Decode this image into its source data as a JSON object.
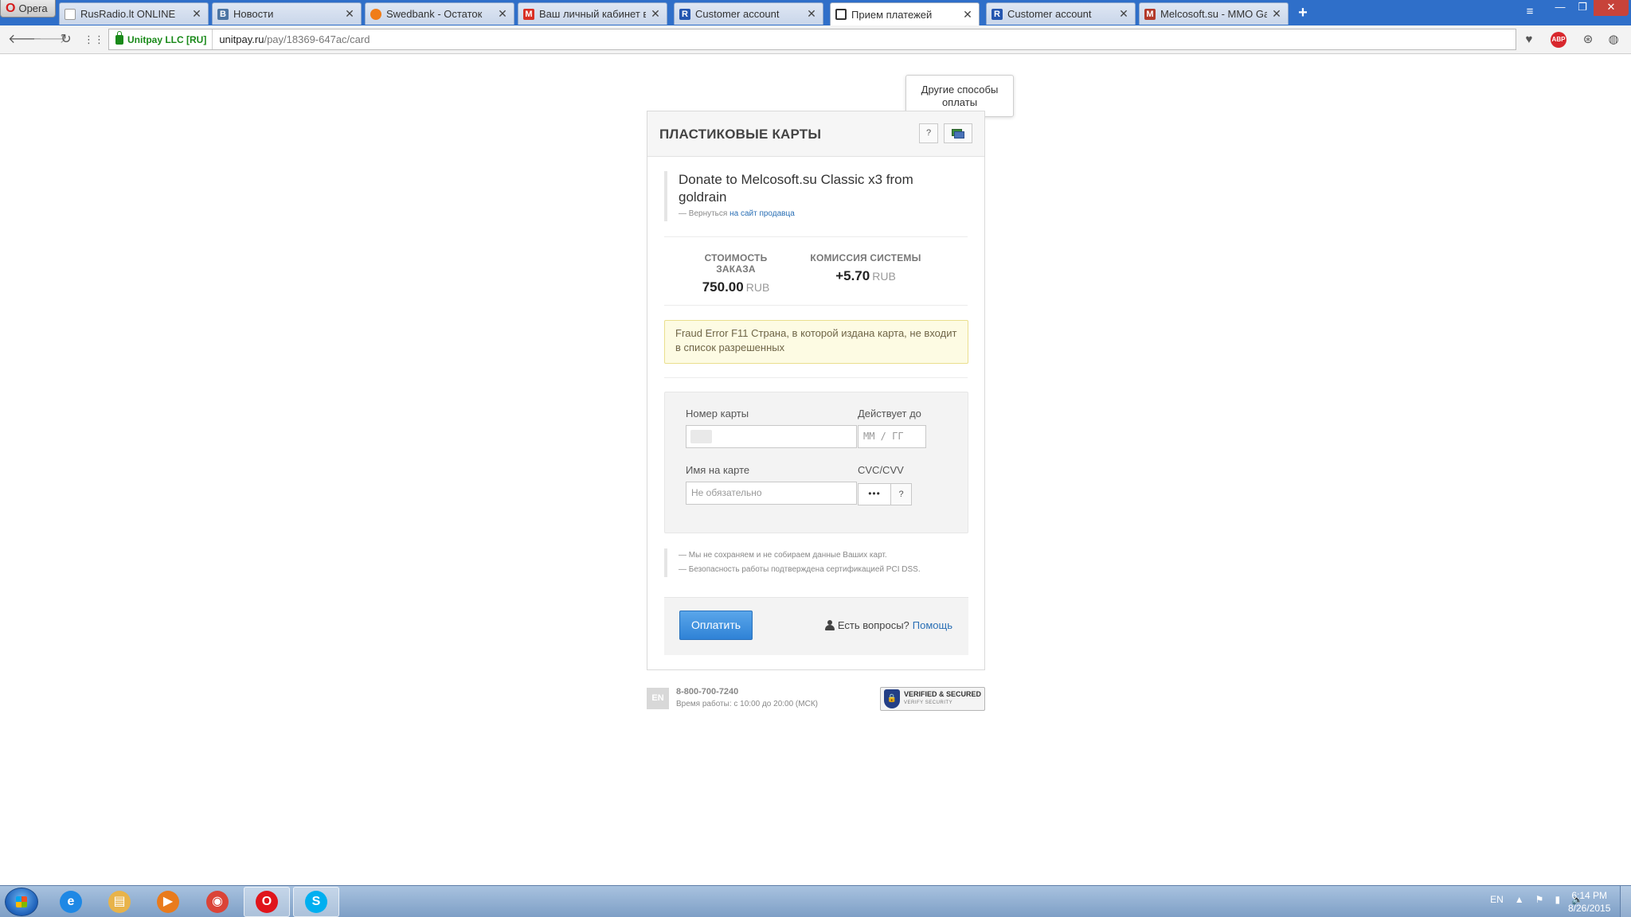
{
  "browser": {
    "menu_label": "Opera",
    "tabs": [
      {
        "title": "RusRadio.lt ONLINE",
        "favicon": "page-icon",
        "color": "#ffffff",
        "letter": "",
        "active": false
      },
      {
        "title": "Новости",
        "favicon": "vk-icon",
        "color": "#4c75a3",
        "letter": "В",
        "active": false
      },
      {
        "title": "Swedbank - Остаток",
        "favicon": "swedbank-icon",
        "color": "#f07d19",
        "letter": "",
        "active": false
      },
      {
        "title": "Ваш личный кабинет в Р",
        "favicon": "gmail-icon",
        "color": "#d93025",
        "letter": "M",
        "active": false
      },
      {
        "title": "Customer account",
        "favicon": "r-icon",
        "color": "#2456b0",
        "letter": "R",
        "active": false
      },
      {
        "title": "Прием платежей",
        "favicon": "document-icon",
        "color": "#333333",
        "letter": "",
        "active": true
      },
      {
        "title": "Customer account",
        "favicon": "r-icon",
        "color": "#2456b0",
        "letter": "R",
        "active": false
      },
      {
        "title": "Melcosoft.su - MMO Gam",
        "favicon": "m-icon",
        "color": "#b33a2a",
        "letter": "M",
        "active": false
      }
    ],
    "new_tab_label": "+",
    "close_glyph": "✕",
    "secure_label": "Unitpay LLC [RU]",
    "url_host": "unitpay.ru",
    "url_path": "/pay/18369-647ac/card",
    "abp_label": "ABP"
  },
  "payment": {
    "title": "ПЛАСТИКОВЫЕ КАРТЫ",
    "help_button": "?",
    "tooltip": "Другие способы оплаты",
    "order_title": "Donate to Melcosoft.su Classic x3 from goldrain",
    "back_prefix": "— Вернуться ",
    "back_link": "на сайт продавца",
    "cost_label": "СТОИМОСТЬ ЗАКАЗА",
    "cost_value": "750.00",
    "currency": "RUB",
    "fee_label": "КОМИССИЯ СИСТЕМЫ",
    "fee_value": "+5.70",
    "error_message": "Fraud Error F11 Страна, в которой издана карта, не входит в список разрешенных",
    "card_number_label": "Номер карты",
    "expiry_label": "Действует до",
    "expiry_placeholder": "ММ / ГГ",
    "name_label": "Имя на карте",
    "name_placeholder": "Не обязательно",
    "cvc_label": "CVC/CVV",
    "cvc_value": "•••",
    "cvc_help": "?",
    "note_1": "— Мы не сохраняем и не собираем данные Ваших карт.",
    "note_2": "— Безопасность работы подтверждена сертификацией PCI DSS.",
    "pay_button": "Оплатить",
    "questions_label": "Есть вопросы?",
    "help_link": "Помощь"
  },
  "footer": {
    "lang": "EN",
    "phone": "8-800-700-7240",
    "hours": "Время работы: с 10:00 до 20:00 (МСК)",
    "verified_line1": "VERIFIED & SECURED",
    "verified_line2": "VERIFY SECURITY"
  },
  "taskbar": {
    "lang": "EN",
    "time": "6:14 PM",
    "date": "8/26/2015",
    "apps": [
      {
        "name": "internet-explorer-icon",
        "color": "#1e88e5",
        "glyph": "e",
        "active": false
      },
      {
        "name": "file-explorer-icon",
        "color": "#e8b34a",
        "glyph": "▤",
        "active": false
      },
      {
        "name": "media-player-icon",
        "color": "#e97b1c",
        "glyph": "▶",
        "active": false
      },
      {
        "name": "chrome-icon",
        "color": "#db4437",
        "glyph": "◉",
        "active": false
      },
      {
        "name": "opera-icon",
        "color": "#e0151b",
        "glyph": "O",
        "active": true
      },
      {
        "name": "skype-icon",
        "color": "#00aff0",
        "glyph": "S",
        "active": true
      }
    ]
  }
}
